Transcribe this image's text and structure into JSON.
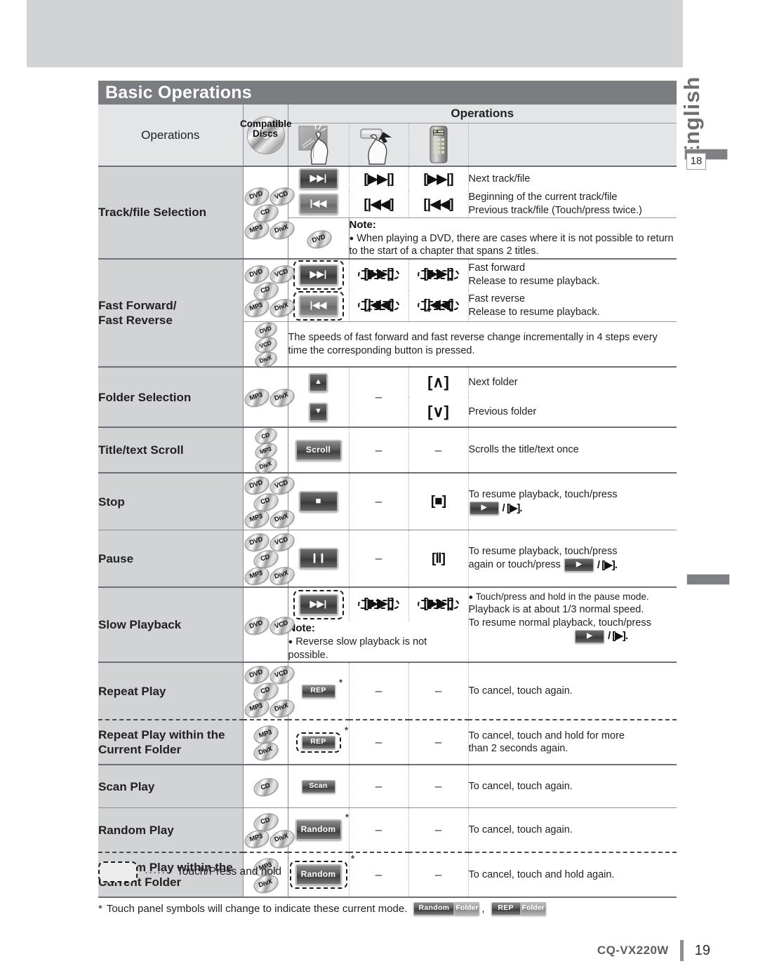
{
  "page": {
    "section_title": "Basic Operations",
    "language_tab": "English",
    "side_page_ref": "18",
    "footer_model": "CQ-VX220W",
    "footer_page": "19"
  },
  "table": {
    "headers": {
      "operations_left": "Operations",
      "compatible_discs_line1": "Compatible",
      "compatible_discs_line2": "Discs",
      "operations_group": "Operations",
      "icon_touch_panel": "touch-panel-hand-icon",
      "icon_press_button": "press-button-hand-icon",
      "icon_remote": "remote-control-icon"
    },
    "rows": [
      {
        "id": "track-file-selection",
        "label": "Track/file Selection",
        "discs": [
          [
            "DVD",
            "VCD"
          ],
          [
            "CD"
          ],
          [
            "MP3",
            "DivX"
          ]
        ],
        "lines": [
          {
            "touch": "next-track-button",
            "button": "[▶▶|]",
            "remote": "[▶▶|]",
            "desc": [
              "Next track/file"
            ]
          },
          {
            "touch": "prev-track-button",
            "button": "[|◀◀]",
            "remote": "[|◀◀]",
            "desc": [
              "Beginning of the current track/file",
              "Previous track/file (Touch/press twice.)"
            ]
          }
        ],
        "note": {
          "discs": [
            "DVD"
          ],
          "title": "Note:",
          "text": "When playing a DVD, there are cases where it is not possible to return to the start of a chapter that spans 2 titles."
        }
      },
      {
        "id": "fast-forward-fast-reverse",
        "label_line1": "Fast Forward/",
        "label_line2": "Fast Reverse",
        "discs": [
          [
            "DVD",
            "VCD"
          ],
          [
            "CD"
          ],
          [
            "MP3",
            "DivX"
          ]
        ],
        "lines": [
          {
            "touch": "fast-forward-button",
            "button": "[▶▶|]",
            "remote": "[▶▶|]",
            "hold": true,
            "desc": [
              "Fast forward",
              "Release to resume playback."
            ]
          },
          {
            "touch": "fast-reverse-button",
            "button": "[|◀◀]",
            "remote": "[|◀◀]",
            "hold": true,
            "desc": [
              "Fast reverse",
              "Release to resume playback."
            ]
          }
        ],
        "subnote": {
          "discs": [
            "DVD",
            "VCD",
            "DivX"
          ],
          "text": "The speeds of fast forward and fast reverse change incrementally in 4 steps every time the corresponding button is pressed."
        }
      },
      {
        "id": "folder-selection",
        "label": "Folder Selection",
        "discs": [
          [
            "MP3",
            "DivX"
          ]
        ],
        "lines": [
          {
            "touch": "folder-up-button",
            "button": "–",
            "remote": "[∧]",
            "desc": [
              "Next folder"
            ]
          },
          {
            "touch": "folder-down-button",
            "button": "",
            "remote": "[∨]",
            "desc": [
              "Previous folder"
            ]
          }
        ]
      },
      {
        "id": "title-text-scroll",
        "label": "Title/text Scroll",
        "discs_inline": [
          "CD",
          "MP3",
          "DivX"
        ],
        "lines": [
          {
            "touch_label": "Scroll",
            "button": "–",
            "remote": "–",
            "desc": [
              "Scrolls the title/text once"
            ]
          }
        ]
      },
      {
        "id": "stop",
        "label": "Stop",
        "discs": [
          [
            "DVD",
            "VCD"
          ],
          [
            "CD"
          ],
          [
            "MP3",
            "DivX"
          ]
        ],
        "lines": [
          {
            "touch": "stop-button",
            "button": "–",
            "remote": "[■]",
            "desc_rich": "stop_resume"
          }
        ]
      },
      {
        "id": "pause",
        "label": "Pause",
        "discs": [
          [
            "DVD",
            "VCD"
          ],
          [
            "CD"
          ],
          [
            "MP3",
            "DivX"
          ]
        ],
        "lines": [
          {
            "touch": "pause-button",
            "button": "–",
            "remote": "[Ⅱ]",
            "desc_rich": "pause_resume"
          }
        ]
      },
      {
        "id": "slow-playback",
        "label": "Slow Playback",
        "discs": [
          [
            "DVD",
            "VCD"
          ]
        ],
        "lines": [
          {
            "touch": "slow-playback-button",
            "button": "[▶▶|]",
            "remote": "[▶▶|]",
            "hold": true,
            "desc_rich": "slow_desc"
          }
        ],
        "note": {
          "title": "Note:",
          "text": "Reverse slow playback is not possible."
        }
      },
      {
        "id": "repeat-play",
        "label": "Repeat Play",
        "discs": [
          [
            "DVD",
            "VCD"
          ],
          [
            "CD"
          ],
          [
            "MP3",
            "DivX"
          ]
        ],
        "lines": [
          {
            "touch_label": "REP",
            "star": true,
            "button": "–",
            "remote": "–",
            "desc": [
              "To cancel, touch again."
            ]
          }
        ]
      },
      {
        "id": "repeat-play-within-folder",
        "label_line1": "Repeat Play within the",
        "label_line2": "Current Folder",
        "discs_inline": [
          "MP3",
          "DivX"
        ],
        "lines": [
          {
            "touch_label": "REP",
            "star": true,
            "hold": true,
            "button": "–",
            "remote": "–",
            "desc": [
              "To cancel, touch and hold for more",
              "than 2 seconds again."
            ]
          }
        ]
      },
      {
        "id": "scan-play",
        "label": "Scan Play",
        "discs_inline": [
          "CD"
        ],
        "lines": [
          {
            "touch_label": "Scan",
            "button": "–",
            "remote": "–",
            "desc": [
              "To cancel, touch again."
            ]
          }
        ]
      },
      {
        "id": "random-play",
        "label": "Random Play",
        "discs": [
          [
            "CD"
          ],
          [
            "MP3",
            "DivX"
          ]
        ],
        "lines": [
          {
            "touch_label": "Random",
            "star": true,
            "button": "–",
            "remote": "–",
            "desc": [
              "To cancel, touch again."
            ]
          }
        ]
      },
      {
        "id": "random-play-within-folder",
        "label_line1": "Random Play within the",
        "label_line2": "Current Folder",
        "discs_inline": [
          "MP3",
          "DivX"
        ],
        "lines": [
          {
            "touch_label": "Random",
            "star": true,
            "hold": true,
            "button": "–",
            "remote": "–",
            "desc": [
              "To cancel, touch and hold again."
            ]
          }
        ]
      }
    ]
  },
  "rich_text": {
    "stop_resume_l1": "To resume playback, touch/press",
    "stop_resume_play_chip": "▶",
    "stop_resume_l2_after": "/ [▶].",
    "pause_resume_l1": "To resume playback, touch/press",
    "pause_resume_l2_before": "again or touch/press",
    "pause_resume_l2_after": "/ [▶].",
    "slow_l1": "Touch/press and hold in the pause mode.",
    "slow_l2": "Playback is at about 1/3 normal speed.",
    "slow_l3": "To resume normal playback, touch/press",
    "slow_l4_after": "/ [▶]."
  },
  "legend": {
    "hold_dots": "······",
    "hold_text": "Touch/Press and hold",
    "footnote_star": "*",
    "footnote_text": "Touch panel symbols will change to indicate these current mode.",
    "chip_random": "Random",
    "chip_folder": "Folder",
    "chip_comma": ",",
    "chip_rep": "REP",
    "chip_folder2": "Folder"
  },
  "colors": {
    "title_bar": "#7b7d80",
    "shade": "#d2d3d5",
    "header_shade": "#e4e5e6",
    "lang_tab": "#6d6e71"
  }
}
